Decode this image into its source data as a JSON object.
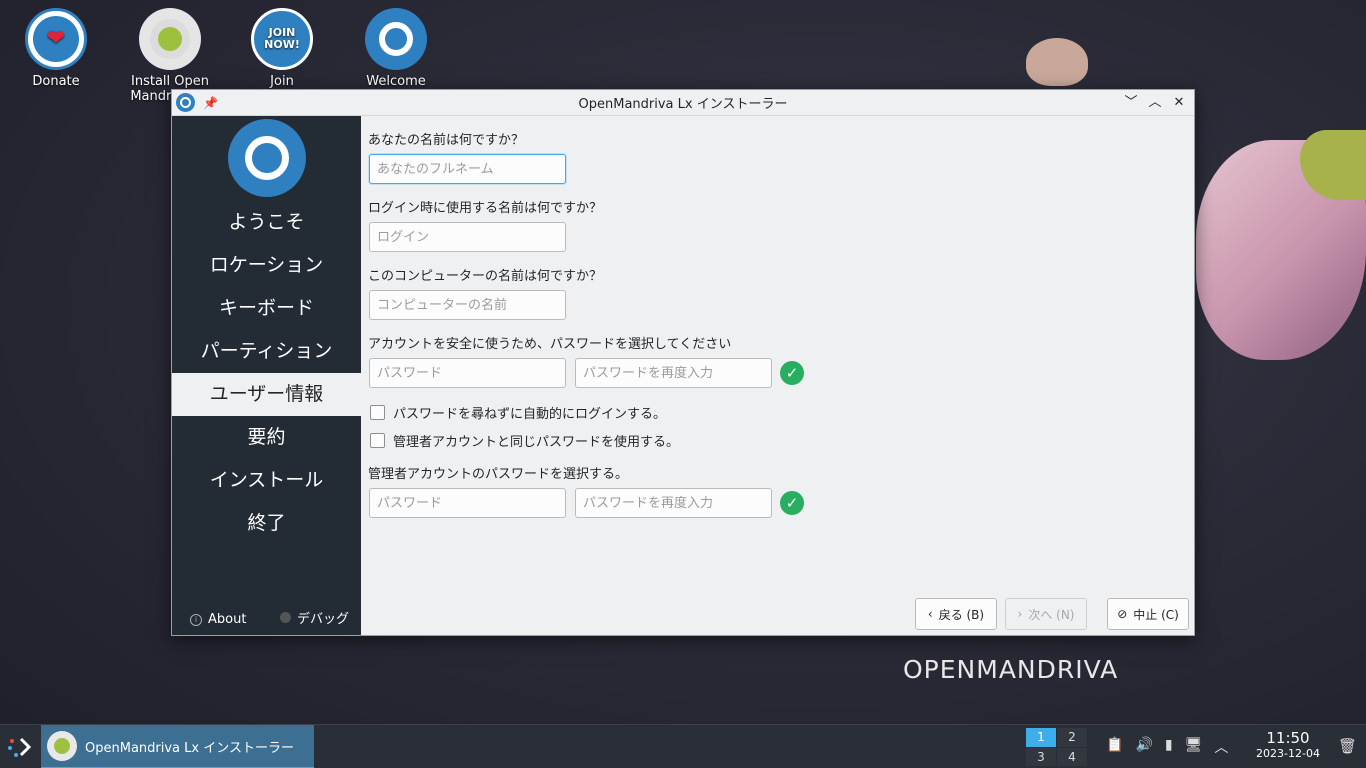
{
  "desktop": {
    "icons": [
      {
        "label": "Donate"
      },
      {
        "label": "Install Open Mandriva Lx"
      },
      {
        "label": "Join"
      },
      {
        "label": "Welcome"
      }
    ],
    "brand": "OPENMANDRIVA"
  },
  "window": {
    "title": "OpenMandriva Lx インストーラー",
    "controls": {
      "minimize": "﹀",
      "maximize": "︿",
      "close": "✕"
    }
  },
  "sidebar": {
    "steps": [
      "ようこそ",
      "ロケーション",
      "キーボード",
      "パーティション",
      "ユーザー情報",
      "要約",
      "インストール",
      "終了"
    ],
    "active_index": 4,
    "about_label": "About",
    "debug_label": "デバッグ"
  },
  "form": {
    "fullname_question": "あなたの名前は何ですか？",
    "fullname_placeholder": "あなたのフルネーム",
    "login_question": "ログイン時に使用する名前は何ですか？",
    "login_placeholder": "ログイン",
    "hostname_question": "このコンピューターの名前は何ですか？",
    "hostname_placeholder": "コンピューターの名前",
    "password_question": "アカウントを安全に使うため、パスワードを選択してください",
    "password_placeholder": "パスワード",
    "password_repeat_placeholder": "パスワードを再度入力",
    "autologin_label": "パスワードを尋ねずに自動的にログインする。",
    "autologin_checked": false,
    "reuse_password_label": "管理者アカウントと同じパスワードを使用する。",
    "reuse_password_checked": false,
    "root_password_question": "管理者アカウントのパスワードを選択する。",
    "root_password_placeholder": "パスワード",
    "root_password_repeat_placeholder": "パスワードを再度入力"
  },
  "buttons": {
    "back": "戻る (B)",
    "next": "次へ (N)",
    "cancel": "中止 (C)"
  },
  "taskbar": {
    "task_label": "OpenMandriva Lx インストーラー",
    "pager": [
      "1",
      "2",
      "3",
      "4"
    ],
    "time": "11:50",
    "date": "2023-12-04"
  },
  "colors": {
    "accent": "#3daee9",
    "sidebar_bg": "#232b35",
    "ok_green": "#27ae60",
    "brand_blue": "#2e80c0"
  }
}
